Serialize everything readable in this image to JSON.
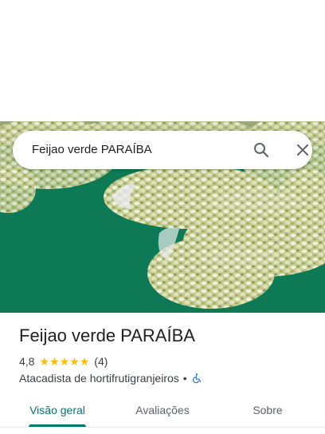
{
  "search": {
    "query": "Feijao verde PARAÍBA",
    "search_icon": "search-icon",
    "close_icon": "close-icon"
  },
  "hero": {
    "image": "photo of bags of green beans on a green surface"
  },
  "place": {
    "name": "Feijao verde PARAÍBA",
    "rating": "4,8",
    "stars": 5,
    "review_count": "(4)",
    "category": "Atacadista de hortifrutigranjeiros",
    "separator": "•",
    "accessibility_icon": "wheelchair-icon"
  },
  "tabs": [
    {
      "label": "Visão geral",
      "active": true
    },
    {
      "label": "Avaliações",
      "active": false
    },
    {
      "label": "Sobre",
      "active": false
    }
  ],
  "colors": {
    "accent": "#00796b",
    "star": "#fbbc04",
    "accessible": "#1a73e8"
  }
}
